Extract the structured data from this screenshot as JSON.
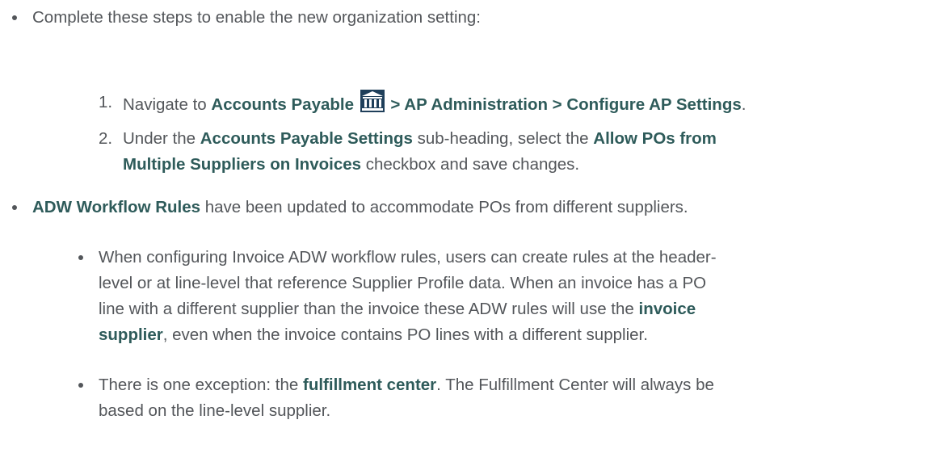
{
  "bullet1": {
    "text": "Complete these steps to enable the new organization setting:"
  },
  "step1": {
    "number": "1.",
    "prefix": "Navigate to ",
    "path_a": "Accounts Payable",
    "icon": "bank-icon",
    "path_b": " > AP Administration > Configure AP Settings",
    "suffix": "."
  },
  "step2": {
    "number": "2.",
    "prefix": "Under the ",
    "heading": "Accounts Payable Settings",
    "middle": " sub-heading, select the ",
    "checkbox_line1": "Allow POs from",
    "checkbox_line2": "Multiple Suppliers on Invoices",
    "suffix": " checkbox and save changes."
  },
  "bullet2": {
    "bold": "ADW Workflow Rules",
    "text": " have been updated to accommodate POs from different suppliers."
  },
  "sub1": {
    "line1": "When configuring Invoice ADW workflow rules, users can create rules at the header-",
    "line2": "level or at line-level that reference Supplier Profile data. When an invoice has a PO",
    "line3": "line with a different supplier than the invoice these ADW rules will use the ",
    "bold_a": "invoice",
    "bold_b": "supplier",
    "line4": ", even when the invoice contains PO lines with a different supplier."
  },
  "sub2": {
    "prefix": "There is one exception: the ",
    "bold": "fulfillment center",
    "line1_rest": ". The Fulfillment Center will always be",
    "line2": "based on the line-level supplier."
  },
  "colors": {
    "text": "#53565a",
    "bold_link": "#2e5b5a"
  }
}
